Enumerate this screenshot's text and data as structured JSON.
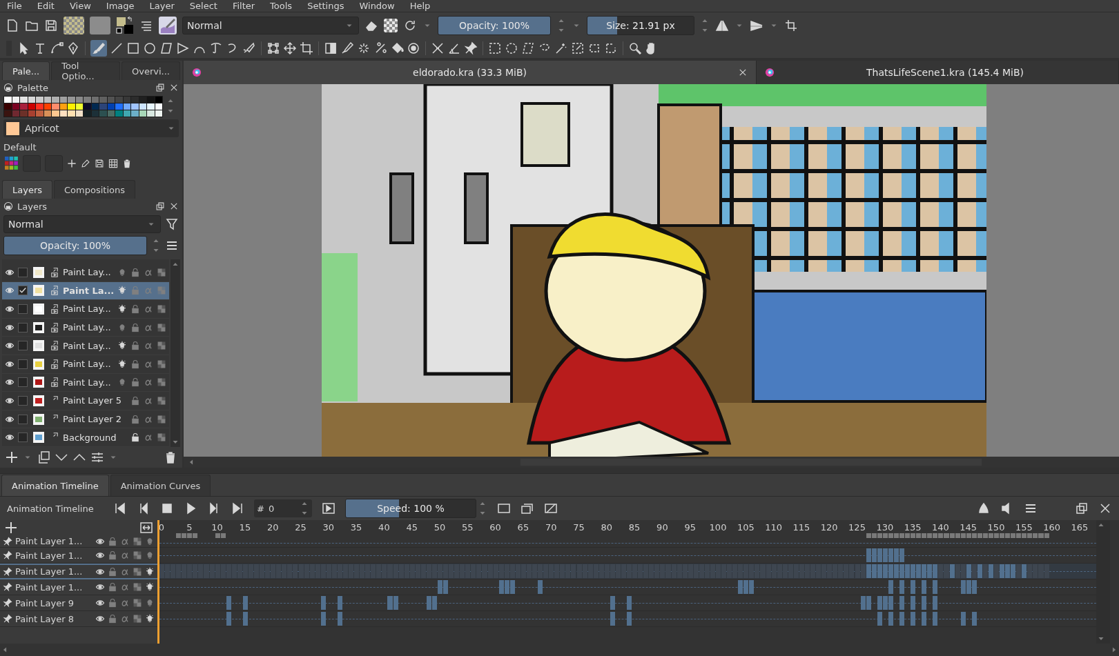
{
  "menu": [
    "File",
    "Edit",
    "View",
    "Image",
    "Layer",
    "Select",
    "Filter",
    "Tools",
    "Settings",
    "Window",
    "Help"
  ],
  "toolbar": {
    "blend_mode": "Normal",
    "opacity": {
      "label": "Opacity: 100%",
      "level": 1
    },
    "size": {
      "label": "Size: 21.91 px",
      "level": 0.28
    }
  },
  "dockers": {
    "tabs": [
      {
        "label": "Pale...",
        "selected": true
      },
      {
        "label": "Tool Optio...",
        "selected": false
      },
      {
        "label": "Overvi...",
        "selected": false
      }
    ]
  },
  "palette": {
    "title": "Palette",
    "rows": [
      [
        {
          "color": "#ffffff"
        },
        {
          "color": "#f0f0f0"
        },
        {
          "color": "#e4e4e4"
        },
        {
          "color": "#d8d8d8"
        },
        {
          "color": "#cccccc"
        },
        {
          "color": "#c0c0c0"
        },
        {
          "color": "#b0b0b0"
        },
        {
          "color": "#a0a0a0"
        },
        {
          "color": "#969696"
        },
        {
          "color": "#8a8a8a"
        },
        {
          "color": "#7c7c7c"
        },
        {
          "color": "#6e6e6e"
        },
        {
          "color": "#606060"
        },
        {
          "color": "#525252"
        },
        {
          "color": "#444444"
        },
        {
          "color": "#383838"
        },
        {
          "color": "#2c2c2c"
        },
        {
          "color": "#202020"
        },
        {
          "color": "#141414"
        },
        {
          "color": "#000000"
        }
      ],
      [
        {
          "color": "#3a0000"
        },
        {
          "color": "#7a0020"
        },
        {
          "color": "#a8203c"
        },
        {
          "color": "#cc0000"
        },
        {
          "color": "#ff3020"
        },
        {
          "color": "#ff4000"
        },
        {
          "color": "#ff8c6c"
        },
        {
          "color": "#ffa010"
        },
        {
          "color": "#fff000"
        },
        {
          "color": "#f0ff30"
        },
        {
          "color": "#0c0c28"
        },
        {
          "color": "#002850"
        },
        {
          "color": "#2c4478"
        },
        {
          "color": "#0040b0"
        },
        {
          "color": "#2070ff"
        },
        {
          "color": "#70a8ff"
        },
        {
          "color": "#a0c4ff"
        },
        {
          "color": "#cce4ff"
        },
        {
          "color": "#e8f6ff"
        },
        {
          "color": "#f8fcff"
        }
      ],
      [
        {
          "color": "#3a1410"
        },
        {
          "color": "#702830"
        },
        {
          "color": "#6c3028"
        },
        {
          "color": "#a84030"
        },
        {
          "color": "#c06040"
        },
        {
          "color": "#d89058"
        },
        {
          "color": "#ffc890"
        },
        {
          "color": "#ffe0c0"
        },
        {
          "color": "#ffe0b0"
        },
        {
          "color": "#f0e0c8"
        },
        {
          "color": "#142024"
        },
        {
          "color": "#1c3038"
        },
        {
          "color": "#2c5050"
        },
        {
          "color": "#4c6c64"
        },
        {
          "color": "#008080"
        },
        {
          "color": "#40a8b0"
        },
        {
          "color": "#6cb0c8"
        },
        {
          "color": "#a8d8b8"
        },
        {
          "color": "#d8e8e0"
        },
        {
          "color": "#eef4f0"
        }
      ]
    ],
    "current": {
      "name": "Apricot",
      "color": "#ffc896"
    },
    "set": "Default"
  },
  "layers_docker": {
    "tabs": [
      {
        "label": "Layers",
        "selected": true
      },
      {
        "label": "Compositions",
        "selected": false
      }
    ],
    "title": "Layers",
    "blend_mode": "Normal",
    "opacity": {
      "label": "Opacity:  100%",
      "level": 1
    },
    "layers": [
      {
        "name": "Paint Lay...",
        "visible": true,
        "checked": false,
        "selected": false,
        "animated": true,
        "onion": false,
        "locked": false
      },
      {
        "name": "Paint La...",
        "visible": true,
        "checked": true,
        "selected": true,
        "animated": true,
        "onion": true,
        "locked": false
      },
      {
        "name": "Paint Lay...",
        "visible": true,
        "checked": false,
        "selected": false,
        "animated": true,
        "onion": true,
        "locked": false
      },
      {
        "name": "Paint Lay...",
        "visible": true,
        "checked": false,
        "selected": false,
        "animated": true,
        "onion": false,
        "locked": false
      },
      {
        "name": "Paint Lay...",
        "visible": true,
        "checked": false,
        "selected": false,
        "animated": true,
        "onion": true,
        "locked": false
      },
      {
        "name": "Paint Lay...",
        "visible": true,
        "checked": false,
        "selected": false,
        "animated": true,
        "onion": true,
        "locked": false
      },
      {
        "name": "Paint Lay...",
        "visible": true,
        "checked": false,
        "selected": false,
        "animated": true,
        "onion": false,
        "locked": false
      },
      {
        "name": "Paint Layer 5",
        "visible": true,
        "checked": false,
        "selected": false,
        "animated": false,
        "locked": false
      },
      {
        "name": "Paint Layer 2",
        "visible": true,
        "checked": false,
        "selected": false,
        "animated": false,
        "locked": false
      },
      {
        "name": "Background",
        "visible": true,
        "checked": false,
        "selected": false,
        "animated": false,
        "locked": true
      }
    ]
  },
  "documents": [
    {
      "title": "eldorado.kra (33.3 MiB)",
      "selected": true,
      "closable": true
    },
    {
      "title": "ThatsLifeScene1.kra (145.4 MiB)",
      "selected": false,
      "closable": false
    }
  ],
  "timeline": {
    "tabs": [
      {
        "label": "Animation Timeline",
        "selected": true
      },
      {
        "label": "Animation Curves",
        "selected": false
      }
    ],
    "title": "Animation Timeline",
    "frame_sign": "#",
    "frame": "0",
    "speed": {
      "label": "Speed: 100 %",
      "level": 0.41
    },
    "frame_labels": [
      "0",
      "5",
      "10",
      "15",
      "20",
      "25",
      "30",
      "35",
      "40",
      "45",
      "50",
      "55",
      "60",
      "65",
      "70",
      "75",
      "80",
      "85",
      "90",
      "95",
      "100",
      "105",
      "110",
      "115",
      "120",
      "125",
      "130",
      "135",
      "140",
      "145",
      "150",
      "155",
      "160",
      "165"
    ],
    "cached": [
      false,
      false,
      false,
      true,
      true,
      true,
      true,
      false,
      false,
      false,
      true,
      true,
      false,
      false,
      false,
      false,
      false,
      false,
      false,
      false,
      false,
      false,
      false,
      false,
      false,
      false,
      false,
      false,
      false,
      false,
      false,
      false,
      false,
      false,
      false,
      false,
      false,
      false,
      false,
      false,
      false,
      false,
      false,
      false,
      false,
      false,
      false,
      false,
      false,
      false,
      false,
      false,
      false,
      false,
      false,
      false,
      false,
      false,
      false,
      false,
      false,
      false,
      false,
      false,
      false,
      false,
      false,
      false,
      false,
      false,
      false,
      false,
      false,
      false,
      false,
      false,
      false,
      false,
      false,
      false,
      false,
      false,
      false,
      false,
      false,
      false,
      false,
      false,
      false,
      false,
      false,
      false,
      false,
      false,
      false,
      false,
      false,
      false,
      false,
      false,
      false,
      false,
      false,
      false,
      false,
      false,
      false,
      false,
      false,
      false,
      false,
      false,
      false,
      false,
      false,
      false,
      false,
      false,
      false,
      false,
      false,
      false,
      false,
      false,
      false,
      false,
      false,
      true,
      true,
      true,
      true,
      true,
      true,
      true,
      true,
      true,
      true,
      true,
      true,
      true,
      true,
      true,
      true,
      true,
      true,
      true,
      true,
      true,
      true,
      true,
      true,
      true,
      true,
      true,
      true,
      true,
      true,
      true,
      true,
      true
    ],
    "rows": [
      {
        "name": "Paint Layer 1...",
        "selected": false,
        "onion": false,
        "keyframes": [
          false,
          false,
          false,
          false,
          false,
          false,
          false,
          false,
          false,
          false,
          false,
          false,
          false,
          false,
          false,
          false,
          false,
          false,
          false,
          false,
          false,
          false,
          false,
          false,
          false,
          false,
          false,
          false,
          false,
          false,
          false,
          false,
          false,
          false,
          false,
          false,
          false,
          false,
          false,
          false,
          false,
          false,
          false,
          false,
          false,
          false,
          false,
          false,
          false,
          false,
          false,
          false,
          false,
          false,
          false,
          false,
          false,
          false,
          false,
          false,
          false,
          false,
          false,
          false,
          false,
          false,
          false,
          false,
          false,
          false,
          false,
          false,
          false,
          false,
          false,
          false,
          false,
          false,
          false,
          false,
          false,
          false,
          false,
          false,
          false,
          false,
          false,
          false,
          false,
          false,
          false,
          false,
          false,
          false,
          false,
          false,
          false,
          false,
          false,
          false,
          false,
          false,
          false,
          false,
          false,
          false,
          false,
          false,
          false,
          false,
          false,
          false,
          false,
          false,
          false,
          false,
          false,
          false,
          false,
          false,
          false,
          false,
          false,
          false,
          false,
          false,
          false,
          false,
          false,
          false,
          false,
          false,
          false,
          false,
          false,
          false,
          false,
          false,
          false,
          false,
          false,
          false,
          false,
          false,
          false,
          false,
          false,
          false,
          false,
          false,
          false,
          false,
          false,
          false,
          false,
          false,
          false,
          false,
          false,
          false
        ]
      },
      {
        "name": "Paint Layer 1...",
        "selected": false,
        "onion": false,
        "keyframes": [
          false,
          false,
          false,
          false,
          false,
          false,
          false,
          false,
          false,
          false,
          false,
          false,
          false,
          false,
          false,
          false,
          false,
          false,
          false,
          false,
          false,
          false,
          false,
          false,
          false,
          false,
          false,
          false,
          false,
          false,
          false,
          false,
          false,
          false,
          false,
          false,
          false,
          false,
          false,
          false,
          false,
          false,
          false,
          false,
          false,
          false,
          false,
          false,
          false,
          false,
          false,
          false,
          false,
          false,
          false,
          false,
          false,
          false,
          false,
          false,
          false,
          false,
          false,
          false,
          false,
          false,
          false,
          false,
          false,
          false,
          false,
          false,
          false,
          false,
          false,
          false,
          false,
          false,
          false,
          false,
          false,
          false,
          false,
          false,
          false,
          false,
          false,
          false,
          false,
          false,
          false,
          false,
          false,
          false,
          false,
          false,
          false,
          false,
          false,
          false,
          false,
          false,
          false,
          false,
          false,
          false,
          false,
          false,
          false,
          false,
          false,
          false,
          false,
          false,
          false,
          false,
          false,
          false,
          false,
          false,
          false,
          false,
          false,
          false,
          false,
          false,
          false,
          true,
          true,
          true,
          true,
          true,
          true,
          true,
          false,
          false,
          false,
          false,
          false,
          false,
          false,
          false,
          false,
          false,
          false,
          false,
          false,
          false,
          false,
          false,
          false,
          false,
          false,
          false,
          false,
          false,
          false,
          false
        ]
      },
      {
        "name": "Paint Layer 1...",
        "selected": true,
        "onion": true,
        "keyframes": [
          false,
          false,
          false,
          false,
          false,
          false,
          false,
          false,
          false,
          false,
          false,
          false,
          false,
          false,
          false,
          false,
          false,
          false,
          false,
          false,
          false,
          false,
          false,
          false,
          false,
          false,
          false,
          false,
          false,
          false,
          false,
          false,
          false,
          false,
          false,
          false,
          false,
          false,
          false,
          false,
          false,
          false,
          false,
          false,
          false,
          false,
          false,
          false,
          false,
          false,
          false,
          false,
          false,
          false,
          false,
          false,
          false,
          false,
          false,
          false,
          false,
          false,
          false,
          false,
          false,
          false,
          false,
          false,
          false,
          false,
          false,
          false,
          false,
          false,
          false,
          false,
          false,
          false,
          false,
          false,
          false,
          false,
          false,
          false,
          false,
          false,
          false,
          false,
          false,
          false,
          false,
          false,
          false,
          false,
          false,
          false,
          false,
          false,
          false,
          false,
          false,
          false,
          false,
          false,
          false,
          false,
          false,
          false,
          false,
          false,
          false,
          false,
          false,
          false,
          false,
          false,
          false,
          false,
          false,
          false,
          false,
          false,
          false,
          false,
          false,
          false,
          false,
          true,
          true,
          true,
          true,
          true,
          true,
          true,
          true,
          true,
          true,
          true,
          true,
          true,
          false,
          false,
          true,
          false,
          false,
          true,
          false,
          true,
          false,
          true,
          false,
          true,
          true,
          true,
          false,
          true,
          false,
          false,
          false,
          false
        ]
      },
      {
        "name": "Paint Layer 1...",
        "selected": false,
        "onion": true,
        "keyframes": [
          false,
          false,
          false,
          false,
          false,
          false,
          false,
          false,
          false,
          false,
          false,
          false,
          false,
          false,
          false,
          false,
          false,
          false,
          false,
          false,
          false,
          false,
          false,
          false,
          false,
          false,
          false,
          false,
          false,
          false,
          false,
          false,
          false,
          false,
          false,
          false,
          false,
          false,
          false,
          false,
          false,
          false,
          false,
          false,
          false,
          false,
          false,
          false,
          false,
          false,
          true,
          true,
          false,
          false,
          false,
          false,
          false,
          false,
          false,
          false,
          false,
          true,
          true,
          true,
          false,
          false,
          false,
          false,
          true,
          false,
          false,
          false,
          false,
          false,
          false,
          false,
          false,
          false,
          false,
          false,
          false,
          false,
          false,
          false,
          false,
          false,
          false,
          false,
          false,
          false,
          false,
          false,
          false,
          false,
          false,
          false,
          false,
          false,
          false,
          false,
          false,
          false,
          false,
          false,
          true,
          true,
          true,
          false,
          false,
          false,
          false,
          false,
          false,
          false,
          false,
          false,
          false,
          false,
          false,
          false,
          false,
          false,
          false,
          false,
          false,
          false,
          false,
          false,
          false,
          false,
          false,
          true,
          false,
          true,
          false,
          true,
          false,
          true,
          false,
          true,
          false,
          false,
          false,
          false,
          true,
          true,
          true,
          false,
          false,
          false,
          false,
          false,
          false,
          false,
          false,
          false,
          false,
          false,
          false,
          false
        ]
      },
      {
        "name": "Paint Layer 9",
        "selected": false,
        "onion": false,
        "keyframes": [
          false,
          false,
          false,
          false,
          false,
          false,
          false,
          false,
          false,
          false,
          false,
          false,
          true,
          false,
          false,
          true,
          false,
          false,
          false,
          false,
          false,
          false,
          false,
          false,
          false,
          false,
          false,
          false,
          false,
          true,
          false,
          false,
          true,
          false,
          false,
          false,
          false,
          false,
          false,
          false,
          false,
          true,
          true,
          false,
          false,
          false,
          false,
          false,
          true,
          true,
          false,
          false,
          false,
          false,
          false,
          false,
          false,
          false,
          false,
          false,
          false,
          false,
          false,
          false,
          false,
          false,
          false,
          false,
          false,
          false,
          false,
          false,
          false,
          false,
          false,
          false,
          false,
          false,
          false,
          false,
          false,
          true,
          false,
          false,
          true,
          false,
          false,
          false,
          false,
          false,
          false,
          false,
          false,
          false,
          false,
          false,
          false,
          false,
          false,
          false,
          false,
          false,
          false,
          false,
          false,
          false,
          false,
          false,
          false,
          false,
          false,
          false,
          false,
          false,
          false,
          false,
          false,
          false,
          false,
          false,
          false,
          false,
          false,
          false,
          false,
          false,
          true,
          true,
          false,
          true,
          true,
          true,
          false,
          true,
          false,
          true,
          false,
          true,
          false,
          true,
          false,
          false,
          false,
          false,
          false,
          false,
          false,
          false,
          false,
          false,
          false,
          false,
          false,
          false,
          false,
          false,
          false,
          false,
          false,
          false
        ]
      },
      {
        "name": "Paint Layer 8",
        "selected": false,
        "onion": true,
        "keyframes": [
          false,
          false,
          false,
          false,
          false,
          false,
          false,
          false,
          false,
          false,
          false,
          false,
          true,
          false,
          false,
          true,
          false,
          false,
          false,
          false,
          false,
          false,
          false,
          false,
          false,
          false,
          false,
          false,
          false,
          true,
          false,
          false,
          true,
          false,
          false,
          false,
          false,
          false,
          false,
          false,
          false,
          false,
          false,
          false,
          false,
          false,
          false,
          false,
          false,
          false,
          false,
          false,
          false,
          false,
          false,
          false,
          false,
          false,
          false,
          false,
          false,
          false,
          false,
          false,
          false,
          false,
          false,
          false,
          false,
          false,
          false,
          false,
          false,
          false,
          false,
          false,
          false,
          false,
          false,
          false,
          false,
          true,
          false,
          false,
          true,
          false,
          false,
          false,
          false,
          false,
          false,
          false,
          false,
          false,
          false,
          false,
          false,
          false,
          false,
          false,
          false,
          false,
          false,
          false,
          false,
          false,
          false,
          false,
          false,
          false,
          false,
          false,
          false,
          false,
          false,
          false,
          false,
          false,
          false,
          false,
          false,
          false,
          false,
          false,
          false,
          false,
          false,
          false,
          false,
          true,
          false,
          true,
          false,
          true,
          false,
          true,
          false,
          true,
          false,
          true,
          false,
          false,
          false,
          false,
          true,
          false,
          true,
          false,
          false,
          false,
          false,
          false,
          false,
          false,
          false,
          false,
          false,
          false,
          false,
          false
        ]
      }
    ]
  }
}
